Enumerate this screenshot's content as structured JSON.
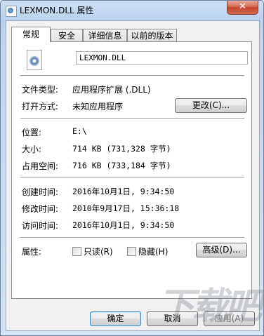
{
  "window": {
    "title": "LEXMON.DLL 属性",
    "close_label": "✕"
  },
  "tabs": [
    {
      "label": "常规",
      "active": true
    },
    {
      "label": "安全"
    },
    {
      "label": "详细信息"
    },
    {
      "label": "以前的版本"
    }
  ],
  "file": {
    "icon": "dll-file-icon",
    "name": "LEXMON.DLL"
  },
  "props": {
    "type_label": "文件类型:",
    "type_value": "应用程序扩展 (.DLL)",
    "open_label": "打开方式:",
    "open_value": "未知应用程序",
    "change_button": "更改(C)...",
    "location_label": "位置:",
    "location_value": "E:\\",
    "size_label": "大小:",
    "size_value": "714 KB (731,328 字节)",
    "disk_label": "占用空间:",
    "disk_value": "716 KB (733,184 字节)",
    "created_label": "创建时间:",
    "created_value": "2016年10月1日, 9:34:50",
    "modified_label": "修改时间:",
    "modified_value": "2010年9月17日, 15:36:18",
    "accessed_label": "访问时间:",
    "accessed_value": "2016年10月1日, 9:34:50",
    "attr_label": "属性:",
    "readonly_label": "只读(R)",
    "hidden_label": "隐藏(H)",
    "advanced_button": "高级(D)..."
  },
  "footer": {
    "ok": "确定",
    "cancel": "取消",
    "apply": "应用(A)"
  },
  "watermark": "下载吧"
}
